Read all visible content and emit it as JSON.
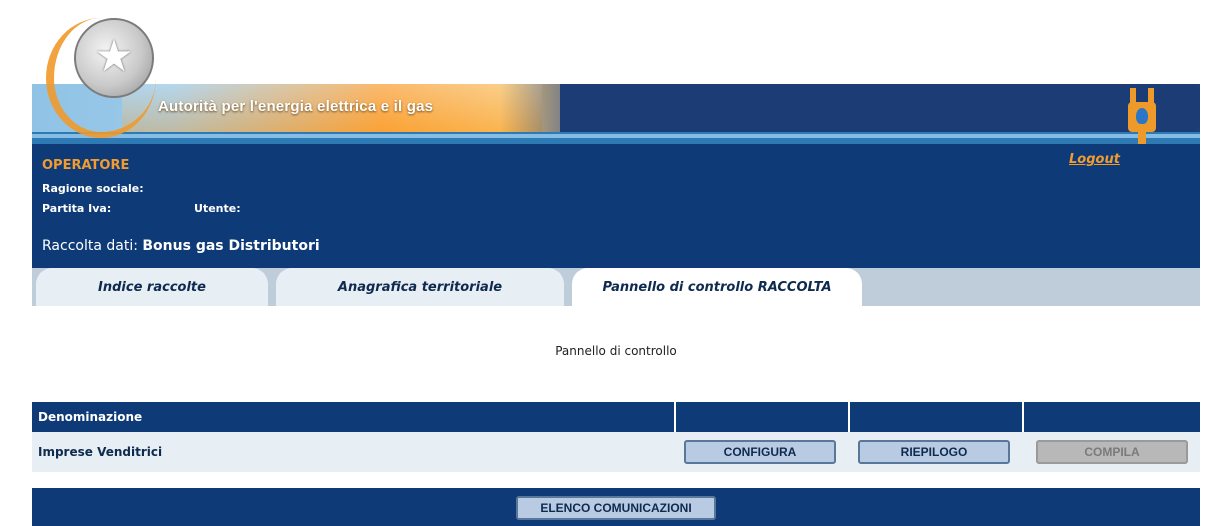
{
  "header": {
    "brand_text": "Autorità per l'energia elettrica e il gas",
    "emblem_icon": "italian-republic-emblem-icon",
    "plug_icon": "gas-plug-icon"
  },
  "operator": {
    "title": "OPERATORE",
    "ragione_sociale_label": "Ragione sociale:",
    "partita_iva_label": "Partita Iva:",
    "utente_label": "Utente:",
    "raccolta_label": "Raccolta dati:",
    "raccolta_value": "Bonus gas Distributori",
    "logout_label": "Logout"
  },
  "tabs": [
    {
      "label": "Indice raccolte",
      "active": false
    },
    {
      "label": "Anagrafica territoriale",
      "active": false
    },
    {
      "label": "Pannello di controllo RACCOLTA",
      "active": true
    }
  ],
  "main": {
    "panel_title": "Pannello di controllo",
    "table": {
      "headers": [
        "Denominazione",
        "",
        "",
        ""
      ],
      "rows": [
        {
          "name": "Imprese Venditrici",
          "configura_label": "CONFIGURA",
          "riepilogo_label": "RIEPILOGO",
          "compila_label": "COMPILA",
          "compila_enabled": false
        }
      ]
    },
    "footer_button_label": "ELENCO COMUNICAZIONI"
  },
  "colors": {
    "navy": "#0f3a78",
    "orange": "#f29c30",
    "tab_inactive": "#e7eef4",
    "tab_bar": "#bfccd9",
    "button": "#b9cbe2"
  }
}
